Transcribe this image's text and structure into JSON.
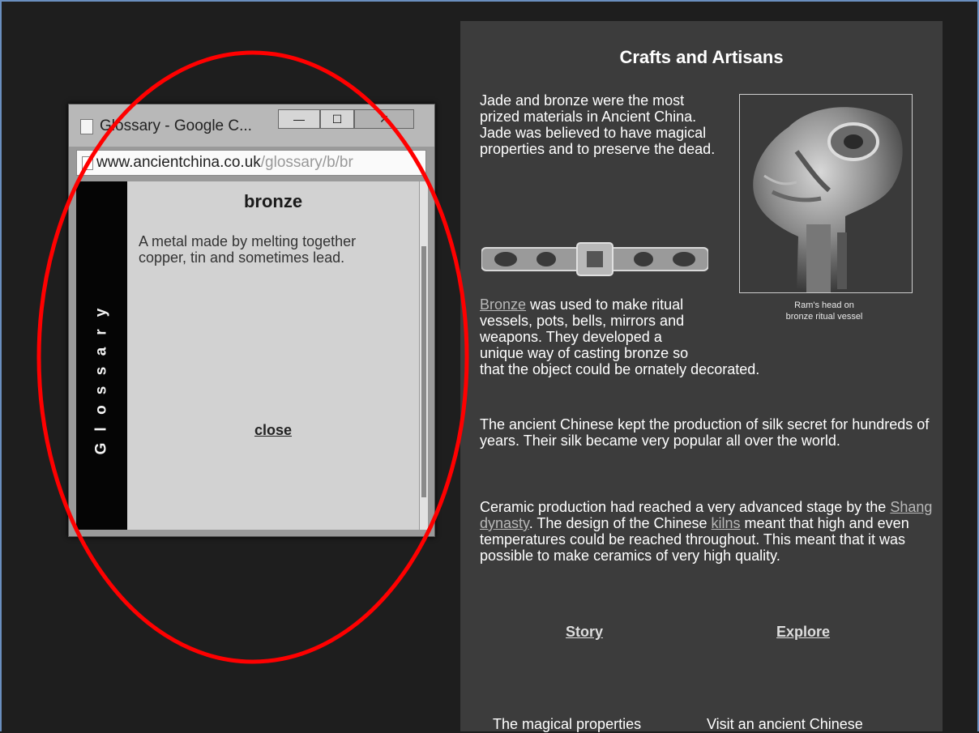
{
  "popup": {
    "title": "Glossary - Google C...",
    "window_buttons": {
      "minimize": "—",
      "maximize": "☐",
      "close": "✕"
    },
    "url_host": "www.ancientchina.co.uk",
    "url_path": "/glossary/b/br",
    "sidebar_label": [
      "G",
      "l",
      "o",
      "s",
      "s",
      "a",
      "r",
      "y"
    ],
    "term": "bronze",
    "definition": "A metal made by melting together copper, tin and sometimes lead.",
    "close_label": "close"
  },
  "annotation": {
    "color": "#ff0000"
  },
  "page": {
    "title": "Crafts and Artisans",
    "p1": "Jade and bronze were the most prized materials in Ancient China. Jade was believed to have magical properties and to preserve the dead.",
    "image_caption_line1": "Ram's head on",
    "image_caption_line2": "bronze ritual vessel",
    "p2_link": "Bronze",
    "p2_text": " was used to make ritual vessels, pots, bells, mirrors and weapons. They developed a unique way of casting bronze so that the object could be ornately decorated.",
    "p3": "The ancient Chinese kept the production of silk secret for hundreds of years. Their silk became very popular all over the world.",
    "p4_a": "Ceramic production had reached a very advanced stage by the ",
    "p4_link1": "Shang dynasty",
    "p4_b": ". The design of the Chinese ",
    "p4_link2": "kilns",
    "p4_c": " meant that high and even temperatures could be reached throughout. This meant that it was possible to make ceramics of very high quality.",
    "nav": {
      "story_label": "Story",
      "story_desc": "The magical properties",
      "explore_label": "Explore",
      "explore_desc": "Visit an ancient Chinese"
    }
  }
}
